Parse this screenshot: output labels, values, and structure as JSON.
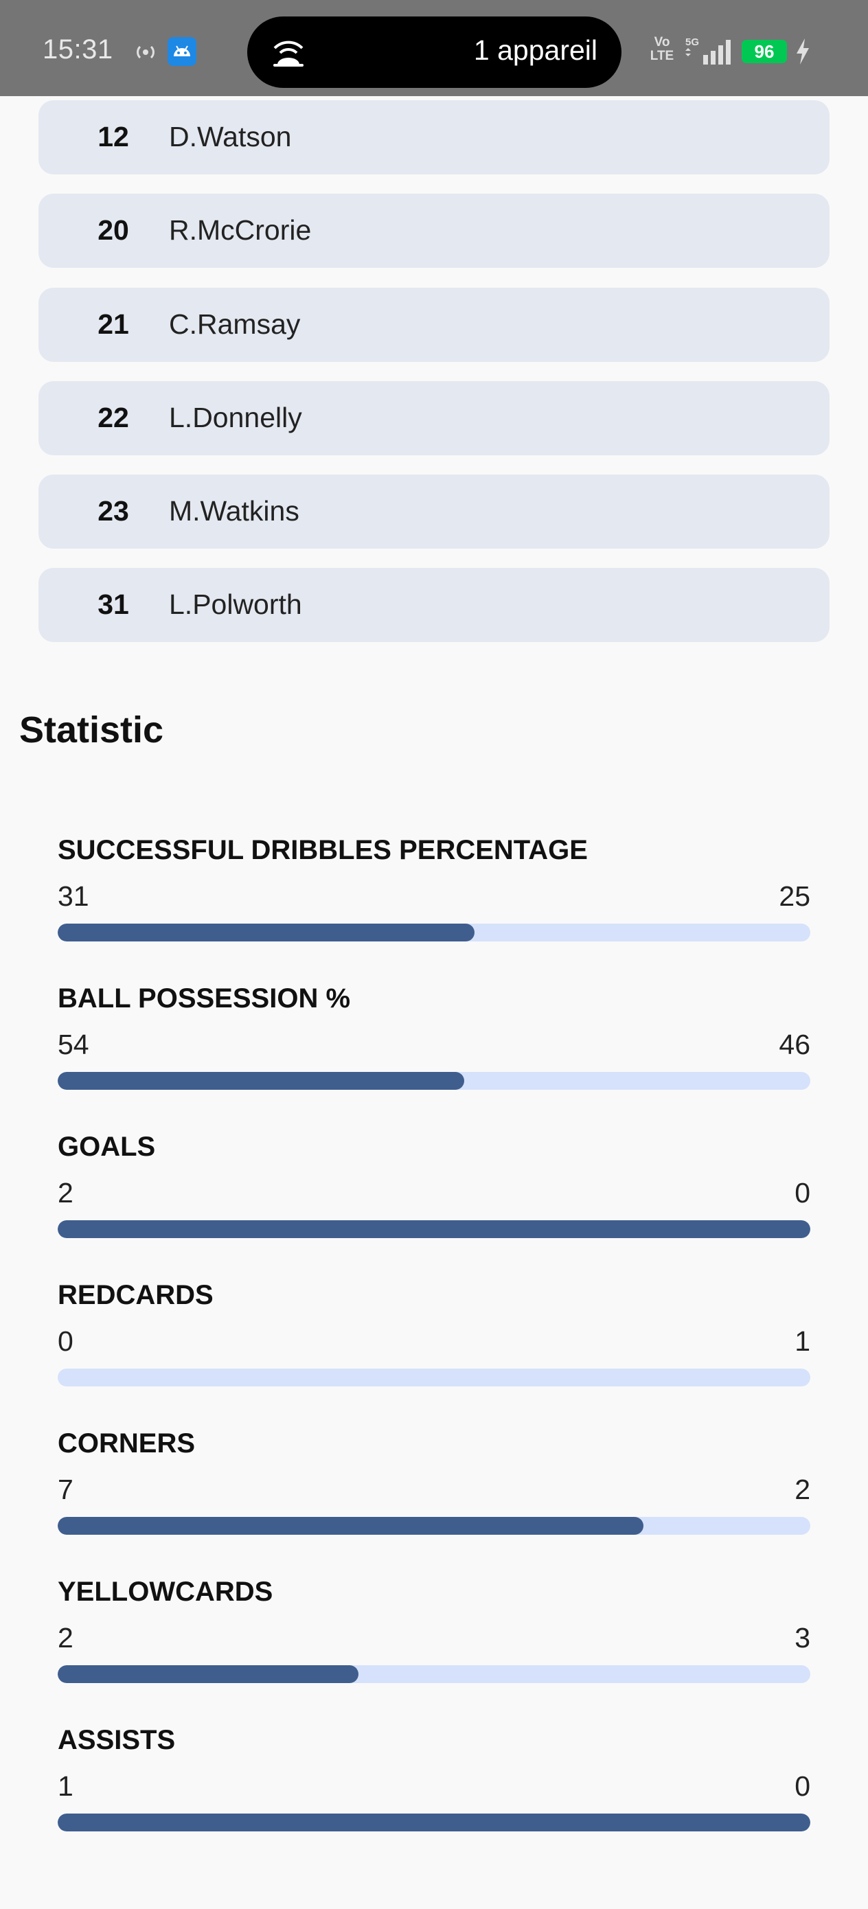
{
  "status_bar": {
    "time": "15:31",
    "hotspot_icon": "hotspot-icon",
    "app_icon": "android-app-icon",
    "pill_icon": "wifi-share-icon",
    "pill_text": "1 appareil",
    "network": "Vo LTE",
    "signal_icon": "signal-5g-icon",
    "battery": "96",
    "charging_icon": "bolt-icon"
  },
  "players": [
    {
      "number": "12",
      "name": "D.Watson"
    },
    {
      "number": "20",
      "name": "R.McCrorie"
    },
    {
      "number": "21",
      "name": "C.Ramsay"
    },
    {
      "number": "22",
      "name": "L.Donnelly"
    },
    {
      "number": "23",
      "name": "M.Watkins"
    },
    {
      "number": "31",
      "name": "L.Polworth"
    }
  ],
  "statistic": {
    "title": "Statistic",
    "items": [
      {
        "label": "SUCCESSFUL DRIBBLES PERCENTAGE",
        "home": "31",
        "away": "25",
        "home_share": 0.554
      },
      {
        "label": "BALL POSSESSION %",
        "home": "54",
        "away": "46",
        "home_share": 0.54
      },
      {
        "label": "GOALS",
        "home": "2",
        "away": "0",
        "home_share": 1.0
      },
      {
        "label": "REDCARDS",
        "home": "0",
        "away": "1",
        "home_share": 0.0
      },
      {
        "label": "CORNERS",
        "home": "7",
        "away": "2",
        "home_share": 0.778
      },
      {
        "label": "YELLOWCARDS",
        "home": "2",
        "away": "3",
        "home_share": 0.4
      },
      {
        "label": "ASSISTS",
        "home": "1",
        "away": "0",
        "home_share": 1.0
      }
    ]
  },
  "colors": {
    "home_bar": "#3f5e8e",
    "away_bar": "#d6e2fb",
    "row_bg": "#e4e8f0",
    "status_bar_bg": "#757575",
    "battery": "#00c853"
  }
}
